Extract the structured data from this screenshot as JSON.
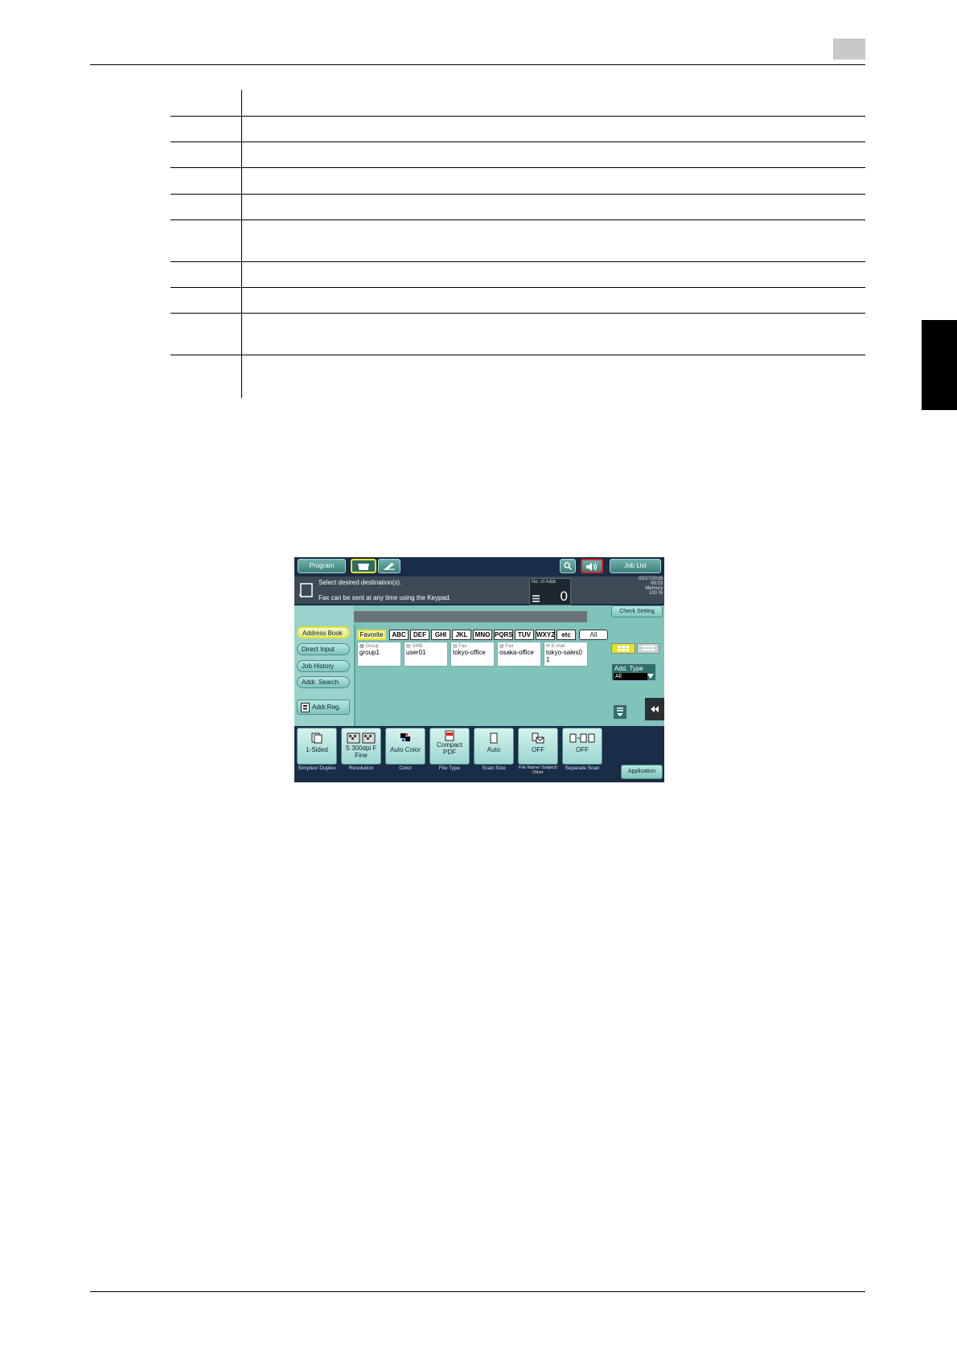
{
  "toolbar": {
    "program": "Program",
    "job_list": "Job List"
  },
  "message": {
    "line1": "Select desired destination(s).",
    "line2": "Fax can be sent at any time using the Keypad."
  },
  "no_of_addr": {
    "label": "No. of Addr.",
    "value": "0"
  },
  "status": {
    "date": "03/27/2016",
    "time": "08:03",
    "memory_label": "Memory",
    "memory_value": "100 %"
  },
  "check_setting": "Check Setting",
  "sidebar": {
    "items": [
      {
        "label": "Address Book"
      },
      {
        "label": "Direct Input"
      },
      {
        "label": "Job History"
      },
      {
        "label": "Addr. Search"
      }
    ],
    "addr_reg": "Addr.Reg."
  },
  "index_tabs": [
    "Favorite",
    "ABC",
    "DEF",
    "GHI",
    "JKL",
    "MNO",
    "PQRS",
    "TUV",
    "WXYZ",
    "etc",
    "All"
  ],
  "destinations": [
    {
      "type": "Group",
      "name": "group1"
    },
    {
      "type": "SMB",
      "name": "user01"
    },
    {
      "type": "Fax",
      "name": "tokyo-office"
    },
    {
      "type": "Fax",
      "name": "osaka-office"
    },
    {
      "type": "E-mail",
      "name": "tokyo-sales01"
    }
  ],
  "add_type": {
    "label": "Add. Type",
    "value": "All"
  },
  "functions": [
    {
      "value": "1-Sided",
      "label": "Simplex/ Duplex"
    },
    {
      "value": "S 300dpi F Fine",
      "label": "Resolution"
    },
    {
      "value": "Auto Color",
      "label": "Color"
    },
    {
      "value": "Compact PDF",
      "label": "File Type"
    },
    {
      "value": "Auto",
      "label": "Scan Size"
    },
    {
      "value": "OFF",
      "label": "File Name/ Subject/ Other"
    },
    {
      "value": "OFF",
      "label": "Separate Scan"
    }
  ],
  "application": "Application",
  "colors": {
    "panel_teal": "#7fc3bb",
    "panel_navy": "#1a2c46",
    "highlight_red": "#e0261e",
    "highlight_yellow": "#e9e22a"
  }
}
